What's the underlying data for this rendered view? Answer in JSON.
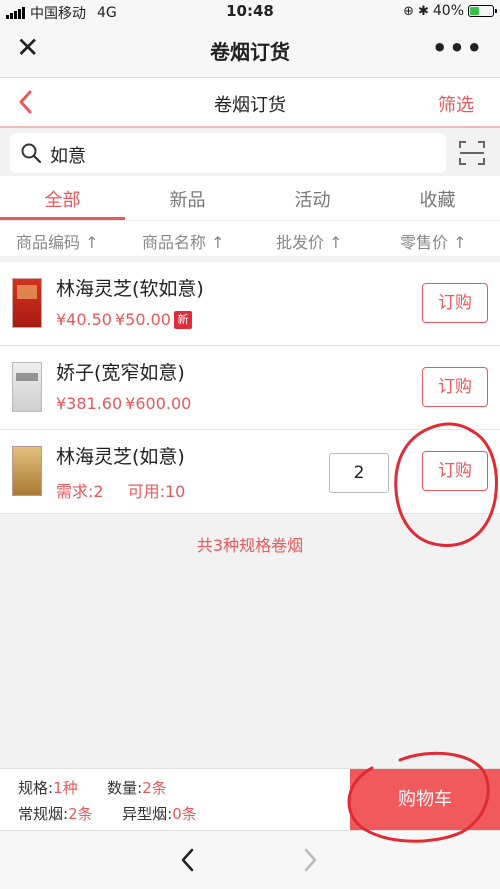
{
  "status_bar": {
    "carrier": "中国移动",
    "network": "4G",
    "time": "10:48",
    "battery": "40%",
    "battery_level": 0.4
  },
  "wechat_header": {
    "title": "卷烟订货"
  },
  "page_header": {
    "title": "卷烟订货",
    "filter_label": "筛选"
  },
  "search": {
    "value": "如意"
  },
  "tabs": [
    {
      "label": "全部",
      "active": true
    },
    {
      "label": "新品",
      "active": false
    },
    {
      "label": "活动",
      "active": false
    },
    {
      "label": "收藏",
      "active": false
    }
  ],
  "sort_columns": [
    {
      "label": "商品编码 ↑"
    },
    {
      "label": "商品名称 ↑"
    },
    {
      "label": "批发价 ↑"
    },
    {
      "label": "零售价 ↑"
    }
  ],
  "products": [
    {
      "name": "林海灵芝(软如意)",
      "wholesale": "¥40.50",
      "retail": "¥50.00",
      "badge": "新",
      "button": "订购",
      "thumb_color": "#c8261e"
    },
    {
      "name": "娇子(宽窄如意)",
      "wholesale": "¥381.60",
      "retail": "¥600.00",
      "button": "订购",
      "thumb_color": "#d8d8d8"
    },
    {
      "name": "林海灵芝(如意)",
      "demand": "需求:2",
      "available": "可用:10",
      "quantity": "2",
      "button": "订购",
      "thumb_color": "#c9a15a"
    }
  ],
  "summary": "共3种规格卷烟",
  "bottom": {
    "spec_label": "规格:",
    "spec_value": "1种",
    "count_label": "数量:",
    "count_value": "2条",
    "regular_label": "常规烟:",
    "regular_value": "2条",
    "special_label": "异型烟:",
    "special_value": "0条",
    "cart_label": "购物车"
  },
  "icons": {
    "close": "close-icon",
    "more": "more-icon",
    "back": "back-arrow-icon",
    "search": "search-icon",
    "scan": "scan-icon",
    "nav_back": "chevron-left-icon",
    "nav_forward": "chevron-right-icon"
  },
  "colors": {
    "accent": "#e6595c",
    "cart": "#f05a5c",
    "annotation": "#e02b35"
  }
}
